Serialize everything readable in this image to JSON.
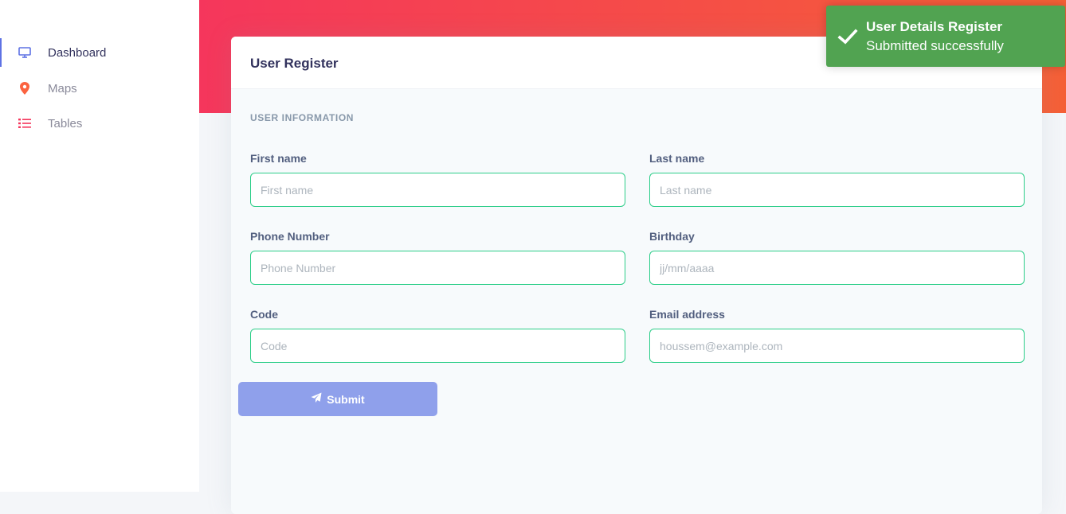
{
  "sidebar": {
    "items": [
      {
        "label": "Dashboard",
        "icon": "monitor-icon",
        "active": true
      },
      {
        "label": "Maps",
        "icon": "map-pin-icon",
        "active": false
      },
      {
        "label": "Tables",
        "icon": "list-icon",
        "active": false
      }
    ]
  },
  "card": {
    "title": "User Register",
    "section_heading": "User information",
    "fields": {
      "first_name": {
        "label": "First name",
        "placeholder": "First name",
        "value": ""
      },
      "last_name": {
        "label": "Last name",
        "placeholder": "Last name",
        "value": ""
      },
      "phone": {
        "label": "Phone Number",
        "placeholder": "Phone Number",
        "value": ""
      },
      "birthday": {
        "label": "Birthday",
        "placeholder": "jj/mm/aaaa",
        "value": ""
      },
      "code": {
        "label": "Code",
        "placeholder": "Code",
        "value": ""
      },
      "email": {
        "label": "Email address",
        "placeholder": "houssem@example.com",
        "value": ""
      }
    },
    "submit_label": "Submit",
    "submit_icon": "paper-plane-icon"
  },
  "toast": {
    "title": "User Details Register",
    "message": "Submitted successfully",
    "icon": "checkmark-icon"
  },
  "colors": {
    "accent": "#5e72e4",
    "banner_start": "#f5365c",
    "banner_end": "#f56036",
    "input_border": "#2dce89",
    "toast_bg": "#51a351",
    "submit_bg": "#8fa0eb"
  }
}
